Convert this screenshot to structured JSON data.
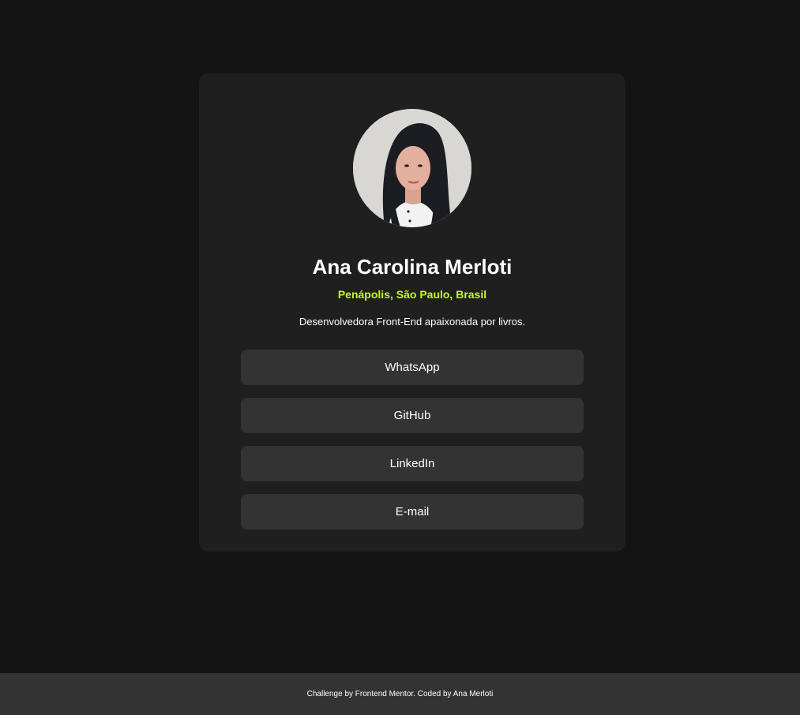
{
  "profile": {
    "name": "Ana Carolina Merloti",
    "location": "Penápolis, São Paulo, Brasil",
    "bio": "Desenvolvedora Front-End apaixonada por livros."
  },
  "links": [
    {
      "label": "WhatsApp"
    },
    {
      "label": "GitHub"
    },
    {
      "label": "LinkedIn"
    },
    {
      "label": "E-mail"
    }
  ],
  "footer": {
    "text": "Challenge by Frontend Mentor. Coded by Ana Merloti"
  },
  "colors": {
    "page_bg": "#141414",
    "card_bg": "#1f1f1f",
    "button_bg": "#333333",
    "accent": "#c4f82a",
    "footer_bg": "#333333"
  }
}
